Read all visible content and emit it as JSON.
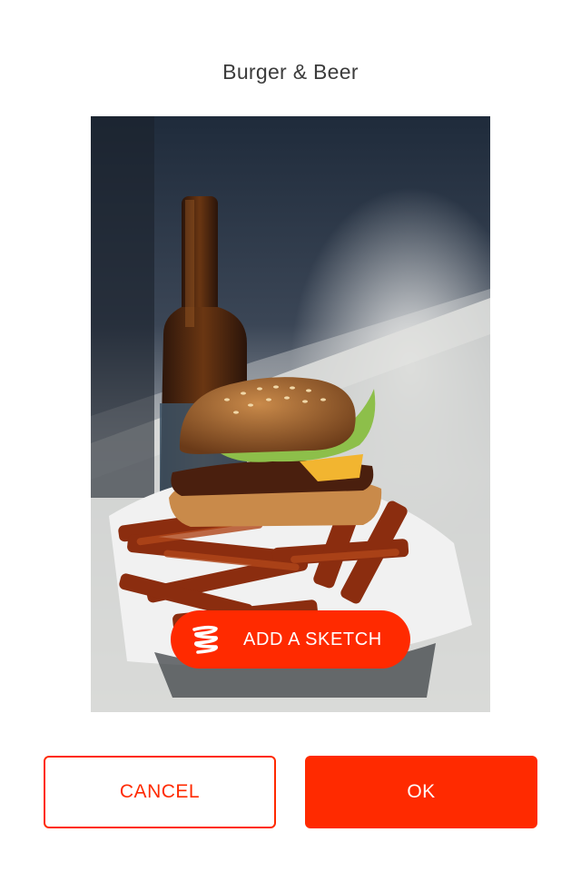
{
  "header": {
    "title": "Burger & Beer"
  },
  "photo": {
    "subject": "burger-and-beer-photo"
  },
  "sketch_button": {
    "label": "ADD A SKETCH",
    "icon": "sketch-squiggle-icon"
  },
  "actions": {
    "cancel_label": "CANCEL",
    "ok_label": "OK"
  },
  "colors": {
    "accent": "#ff2a00",
    "title_text": "#3c3c3c",
    "background": "#ffffff"
  }
}
